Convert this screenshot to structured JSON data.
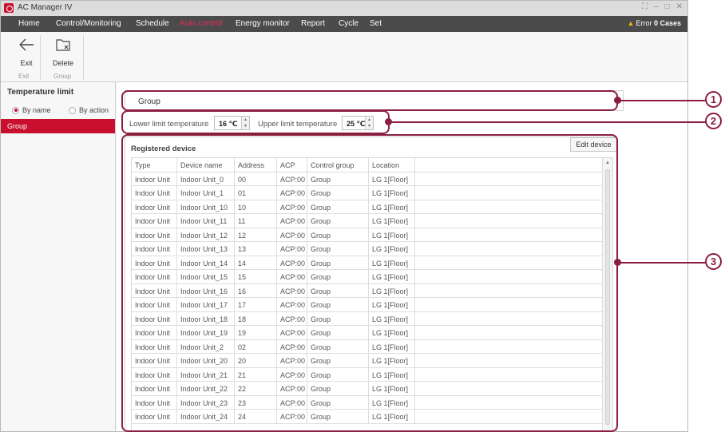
{
  "app": {
    "title": "AC Manager IV",
    "window_controls": [
      "⛶",
      "–",
      "□",
      "✕"
    ]
  },
  "menu": {
    "items": [
      "Home",
      "Control/Monitoring",
      "Schedule",
      "Auto control",
      "Energy monitor",
      "Report",
      "Cycle",
      "Set"
    ],
    "active": "Auto control",
    "error_label": "Error",
    "error_count": "0 Cases"
  },
  "ribbon": {
    "exit_label": "Exit",
    "delete_label": "Delete",
    "group_exit": "Exit",
    "group_group": "Group"
  },
  "left_panel": {
    "title": "Temperature limit",
    "radio_by_name": "By name",
    "radio_by_action": "By action",
    "selected_radio": "By name",
    "items": [
      "Group"
    ]
  },
  "content": {
    "group_name": "Group",
    "lower_label": "Lower limit temperature",
    "lower_value": "16 ℃",
    "upper_label": "Upper limit temperature",
    "upper_value": "25 ℃",
    "registered_title": "Registered device",
    "edit_button": "Edit device"
  },
  "table": {
    "columns": [
      "Type",
      "Device name",
      "Address",
      "ACP",
      "Control group",
      "Location"
    ],
    "rows": [
      [
        "Indoor Unit",
        "Indoor Unit_0",
        "00",
        "ACP:00",
        "Group",
        "LG  1[Floor]"
      ],
      [
        "Indoor Unit",
        "Indoor Unit_1",
        "01",
        "ACP:00",
        "Group",
        "LG  1[Floor]"
      ],
      [
        "Indoor Unit",
        "Indoor Unit_10",
        "10",
        "ACP:00",
        "Group",
        "LG  1[Floor]"
      ],
      [
        "Indoor Unit",
        "Indoor Unit_11",
        "11",
        "ACP:00",
        "Group",
        "LG  1[Floor]"
      ],
      [
        "Indoor Unit",
        "Indoor Unit_12",
        "12",
        "ACP:00",
        "Group",
        "LG  1[Floor]"
      ],
      [
        "Indoor Unit",
        "Indoor Unit_13",
        "13",
        "ACP:00",
        "Group",
        "LG  1[Floor]"
      ],
      [
        "Indoor Unit",
        "Indoor Unit_14",
        "14",
        "ACP:00",
        "Group",
        "LG  1[Floor]"
      ],
      [
        "Indoor Unit",
        "Indoor Unit_15",
        "15",
        "ACP:00",
        "Group",
        "LG  1[Floor]"
      ],
      [
        "Indoor Unit",
        "Indoor Unit_16",
        "16",
        "ACP:00",
        "Group",
        "LG  1[Floor]"
      ],
      [
        "Indoor Unit",
        "Indoor Unit_17",
        "17",
        "ACP:00",
        "Group",
        "LG  1[Floor]"
      ],
      [
        "Indoor Unit",
        "Indoor Unit_18",
        "18",
        "ACP:00",
        "Group",
        "LG  1[Floor]"
      ],
      [
        "Indoor Unit",
        "Indoor Unit_19",
        "19",
        "ACP:00",
        "Group",
        "LG  1[Floor]"
      ],
      [
        "Indoor Unit",
        "Indoor Unit_2",
        "02",
        "ACP:00",
        "Group",
        "LG  1[Floor]"
      ],
      [
        "Indoor Unit",
        "Indoor Unit_20",
        "20",
        "ACP:00",
        "Group",
        "LG  1[Floor]"
      ],
      [
        "Indoor Unit",
        "Indoor Unit_21",
        "21",
        "ACP:00",
        "Group",
        "LG  1[Floor]"
      ],
      [
        "Indoor Unit",
        "Indoor Unit_22",
        "22",
        "ACP:00",
        "Group",
        "LG  1[Floor]"
      ],
      [
        "Indoor Unit",
        "Indoor Unit_23",
        "23",
        "ACP:00",
        "Group",
        "LG  1[Floor]"
      ],
      [
        "Indoor Unit",
        "Indoor Unit_24",
        "24",
        "ACP:00",
        "Group",
        "LG  1[Floor]"
      ]
    ]
  },
  "callouts": [
    "1",
    "2",
    "3"
  ],
  "colors": {
    "accent": "#c8102e",
    "menu_bg": "#4b4b4b",
    "callout": "#8b1d3f",
    "active_menu": "#e7295a"
  },
  "icons": {
    "exit": "arrow-left-icon",
    "delete": "folder-delete-icon",
    "warning": "warning-icon"
  }
}
